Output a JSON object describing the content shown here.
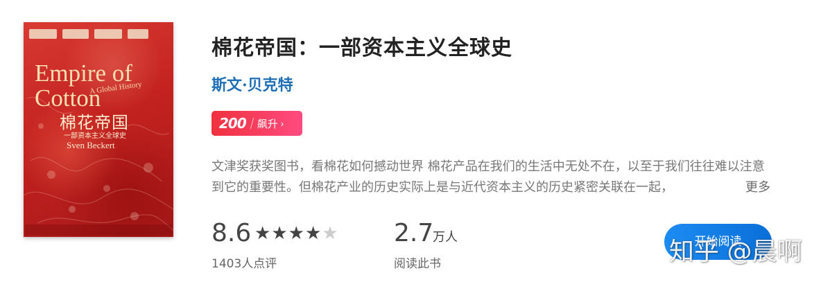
{
  "book": {
    "cover": {
      "title_en": "Empire of Cotton",
      "subtitle_en": "A Global History",
      "title_zh": "棉花帝国",
      "subtitle_zh": "一部资本主义全球史",
      "author_en": "Sven Beckert"
    },
    "title": "棉花帝国：一部资本主义全球史",
    "author": "斯文·贝克特",
    "badge": {
      "number": "200",
      "label": "飙升"
    },
    "description": "文津奖获奖图书，看棉花如何撼动世界 棉花产品在我们的生活中无处不在，以至于我们往往难以注意到它的重要性。但棉花产业的历史实际上是与近代资本主义的历史紧密关联在一起，",
    "more_label": "更多"
  },
  "stats": {
    "rating": {
      "value": "8.6",
      "stars": 4,
      "max_stars": 5,
      "label": "1403人点评"
    },
    "reads": {
      "value": "2.7",
      "unit": "万人",
      "label": "阅读此书"
    }
  },
  "read_button": {
    "label": "开始阅读"
  },
  "watermark": "知乎 @晨啊",
  "colors": {
    "accent": "#1e6fb6",
    "badge_start": "#f0313f",
    "badge_end": "#ff4b80",
    "button": "#1c8cf2"
  }
}
